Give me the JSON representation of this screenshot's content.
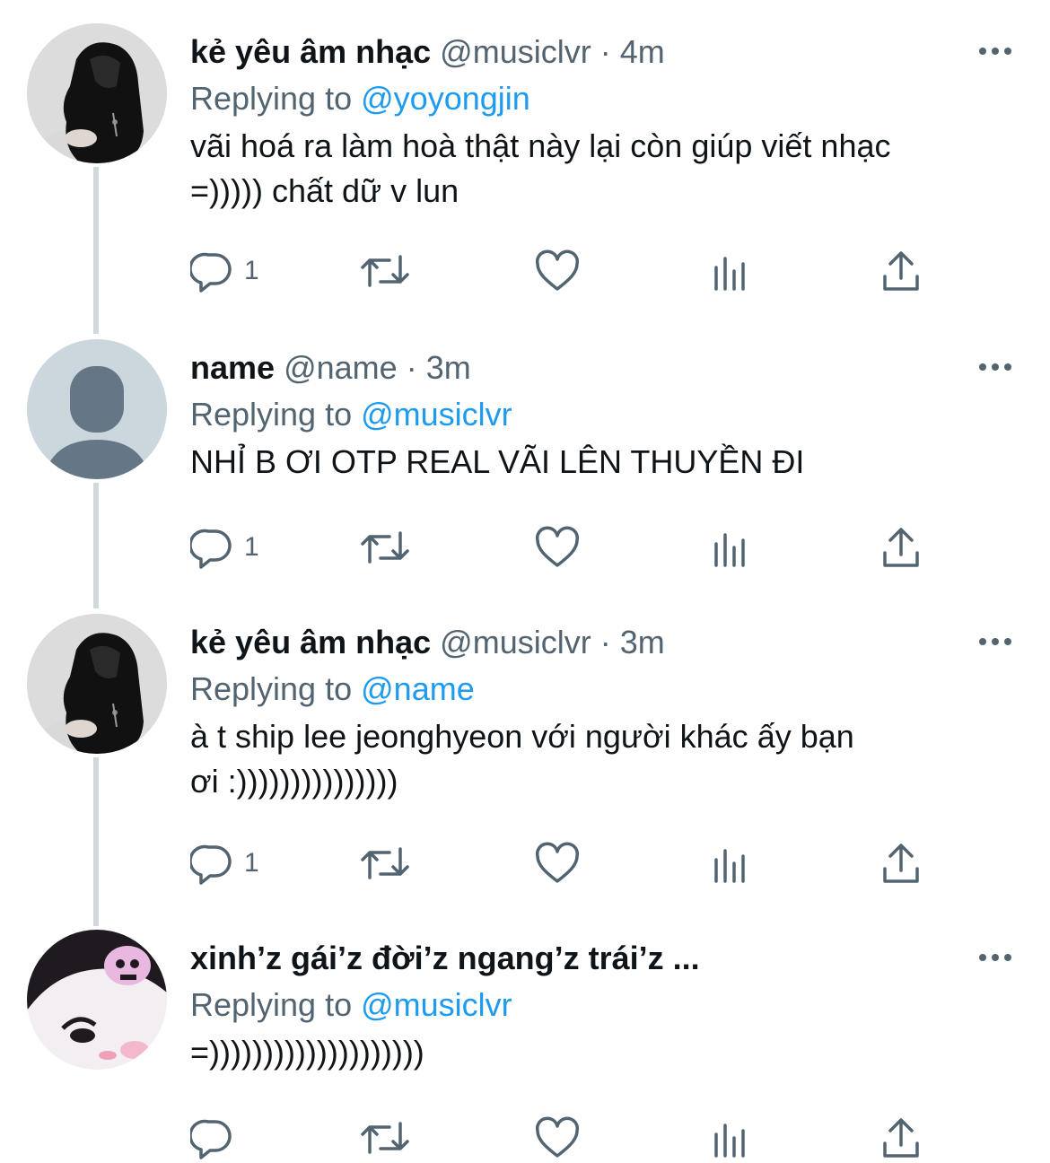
{
  "colors": {
    "text": "#0f1419",
    "secondary": "#536471",
    "accent": "#1d9bf0",
    "thread_line": "#cfd9de"
  },
  "tweets": [
    {
      "display_name": "kẻ yêu âm nhạc",
      "handle": "@musiclvr",
      "separator": "·",
      "time": "4m",
      "replying_label": "Replying to",
      "replying_to": "@yoyongjin",
      "text": "vãi hoá ra làm hoà thật này lại còn giúp viết nhạc\n=))))) chất dữ v lun",
      "reply_count": "1",
      "avatar": "hooded-person-photo"
    },
    {
      "display_name": "name",
      "handle": "@name",
      "separator": "·",
      "time": "3m",
      "replying_label": "Replying to",
      "replying_to": "@musiclvr",
      "text": "NHỈ B ƠI OTP REAL VÃI LÊN THUYỀN ĐI",
      "reply_count": "1",
      "avatar": "default-profile-icon"
    },
    {
      "display_name": "kẻ yêu âm nhạc",
      "handle": "@musiclvr",
      "separator": "·",
      "time": "3m",
      "replying_label": "Replying to",
      "replying_to": "@name",
      "text": "à t ship lee jeonghyeon với người khác ấy bạn\nơi :)))))))))))))))",
      "reply_count": "1",
      "avatar": "hooded-person-photo"
    },
    {
      "display_name": "xinh’z gái’z đời’z ngang’z trái’z ...",
      "handle": "",
      "separator": "",
      "time": "",
      "replying_label": "Replying to",
      "replying_to": "@musiclvr",
      "text": "=))))))))))))))))))))",
      "reply_count": "",
      "avatar": "kuromi-character"
    }
  ],
  "action_icons": [
    "reply-icon",
    "retweet-icon",
    "like-icon",
    "analytics-icon",
    "share-icon"
  ]
}
